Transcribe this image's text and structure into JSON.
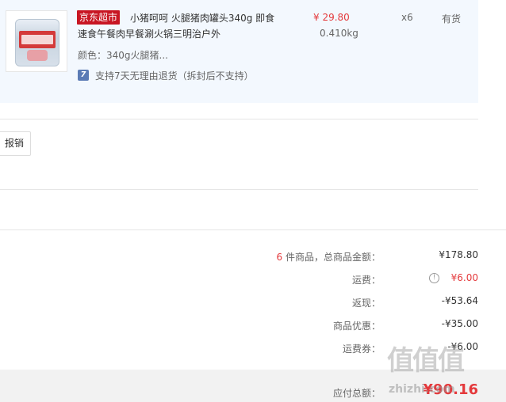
{
  "product": {
    "store_badge": "京东超市",
    "title": "小猪呵呵 火腿猪肉罐头340g 即食速食午餐肉早餐涮火锅三明治户外",
    "variant": "颜色：340g火腿猪...",
    "return_icon": "7",
    "return_text": "支持7天无理由退货（拆封后不支持）",
    "price": "¥ 29.80",
    "weight": "0.410kg",
    "quantity": "x6",
    "stock": "有货"
  },
  "reimbursement_button": "报销",
  "summary": {
    "items": [
      {
        "count": "6",
        "label": " 件商品，总商品金额：",
        "value": "¥178.80"
      },
      {
        "label": "运费：",
        "value": "¥6.00",
        "highlight": true
      },
      {
        "label": "返现：",
        "value": "-¥53.64"
      },
      {
        "label": "商品优惠：",
        "value": "-¥35.00"
      },
      {
        "label": "运费券：",
        "value": "-¥6.00"
      }
    ],
    "total_label": "应付总额：",
    "total_value": "¥90.16"
  },
  "watermark": {
    "chars": "值值值",
    "url": "zhizhi.com"
  },
  "icons": {
    "info": "info-circle-icon",
    "return": "return-badge-icon"
  }
}
